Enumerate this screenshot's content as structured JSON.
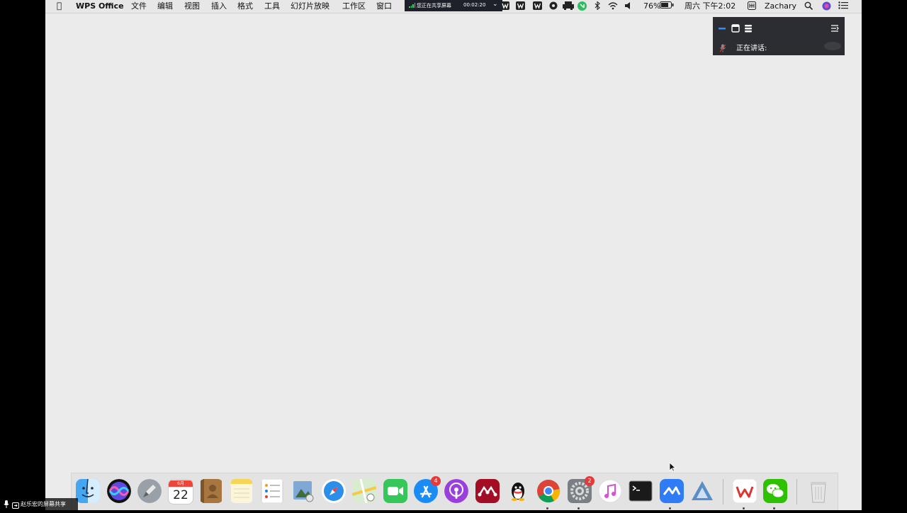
{
  "menubar": {
    "app_name": "WPS Office",
    "items": [
      "文件",
      "编辑",
      "视图",
      "插入",
      "格式",
      "工具",
      "幻灯片放映",
      "工作区",
      "窗口"
    ],
    "share_bar": {
      "status": "您正在共享屏幕",
      "timer": "00:02:20"
    },
    "battery": "76%",
    "clock": "周六 下午2:02",
    "user": "Zachary"
  },
  "speaker_panel": {
    "label": "正在讲话:"
  },
  "dock": {
    "calendar": {
      "month": "6月",
      "day": "22"
    },
    "app_store_badge": "4",
    "system_preferences_badge": "2"
  },
  "share_indicator": {
    "text": "赵乐宏的屏幕共享"
  },
  "colors": {
    "desktop": "#ebebeb",
    "menubar": "#e7e7e7",
    "share_bar": "#1e2129",
    "accent": "#1a7cf5",
    "badge": "#e23b3b"
  }
}
